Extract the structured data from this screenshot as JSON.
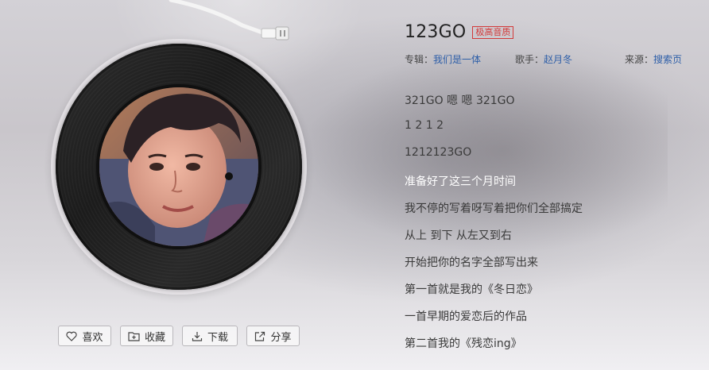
{
  "song": {
    "title": "123GO",
    "quality_badge": "极高音质",
    "album_label": "专辑：",
    "album": "我们是一体",
    "singer_label": "歌手：",
    "singer": "赵月冬",
    "source_label": "来源：",
    "source": "搜索页"
  },
  "actions": {
    "like": "喜欢",
    "favorite": "收藏",
    "download": "下载",
    "share": "分享"
  },
  "lyrics": [
    "321GO 嗯 嗯 321GO",
    "1 2 1 2",
    "1212123GO",
    "准备好了这三个月时间",
    "我不停的写着呀写着把你们全部搞定",
    "从上 到下 从左又到右",
    "开始把你的名字全部写出来",
    "第一首就是我的《冬日恋》",
    "一首早期的爱恋后的作品",
    "第二首我的《残恋ing》"
  ],
  "active_lyric_index": 3,
  "colors": {
    "link": "#2d5ea8",
    "badge": "#d23a3a",
    "active_lyric": "#ffffff"
  },
  "icons": [
    "heart-icon",
    "folder-plus-icon",
    "download-icon",
    "share-icon"
  ]
}
